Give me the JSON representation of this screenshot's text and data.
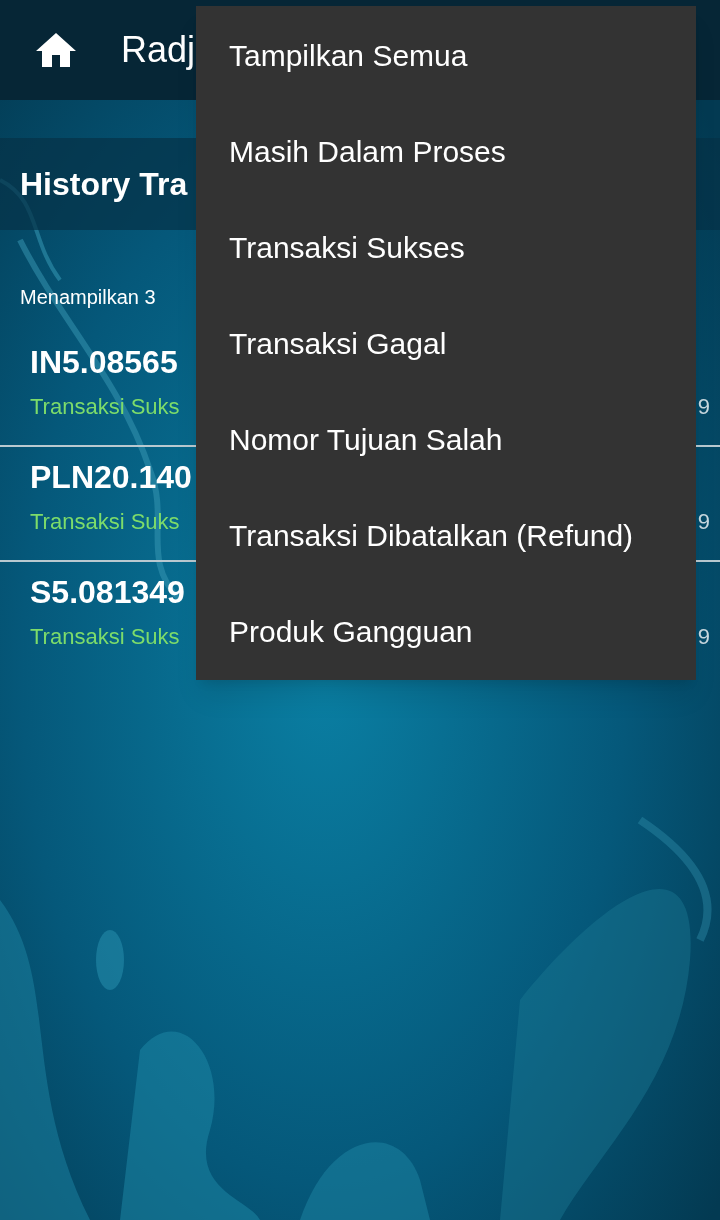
{
  "app_bar": {
    "title": "Radj"
  },
  "header": {
    "title": "History Tra"
  },
  "summary": "Menampilkan 3",
  "transactions": [
    {
      "id": "IN5.08565",
      "status": "Transaksi Suks",
      "column_3": "9"
    },
    {
      "id": "PLN20.140",
      "status": "Transaksi Suks",
      "column_3": "9"
    },
    {
      "id": "S5.081349",
      "status": "Transaksi Suks",
      "column_3": "9"
    }
  ],
  "menu": {
    "items": [
      {
        "label": "Tampilkan Semua"
      },
      {
        "label": "Masih Dalam Proses"
      },
      {
        "label": "Transaksi Sukses"
      },
      {
        "label": "Transaksi Gagal"
      },
      {
        "label": "Nomor Tujuan Salah"
      },
      {
        "label": "Transaksi Dibatalkan (Refund)"
      },
      {
        "label": "Produk Gangguan"
      }
    ]
  }
}
